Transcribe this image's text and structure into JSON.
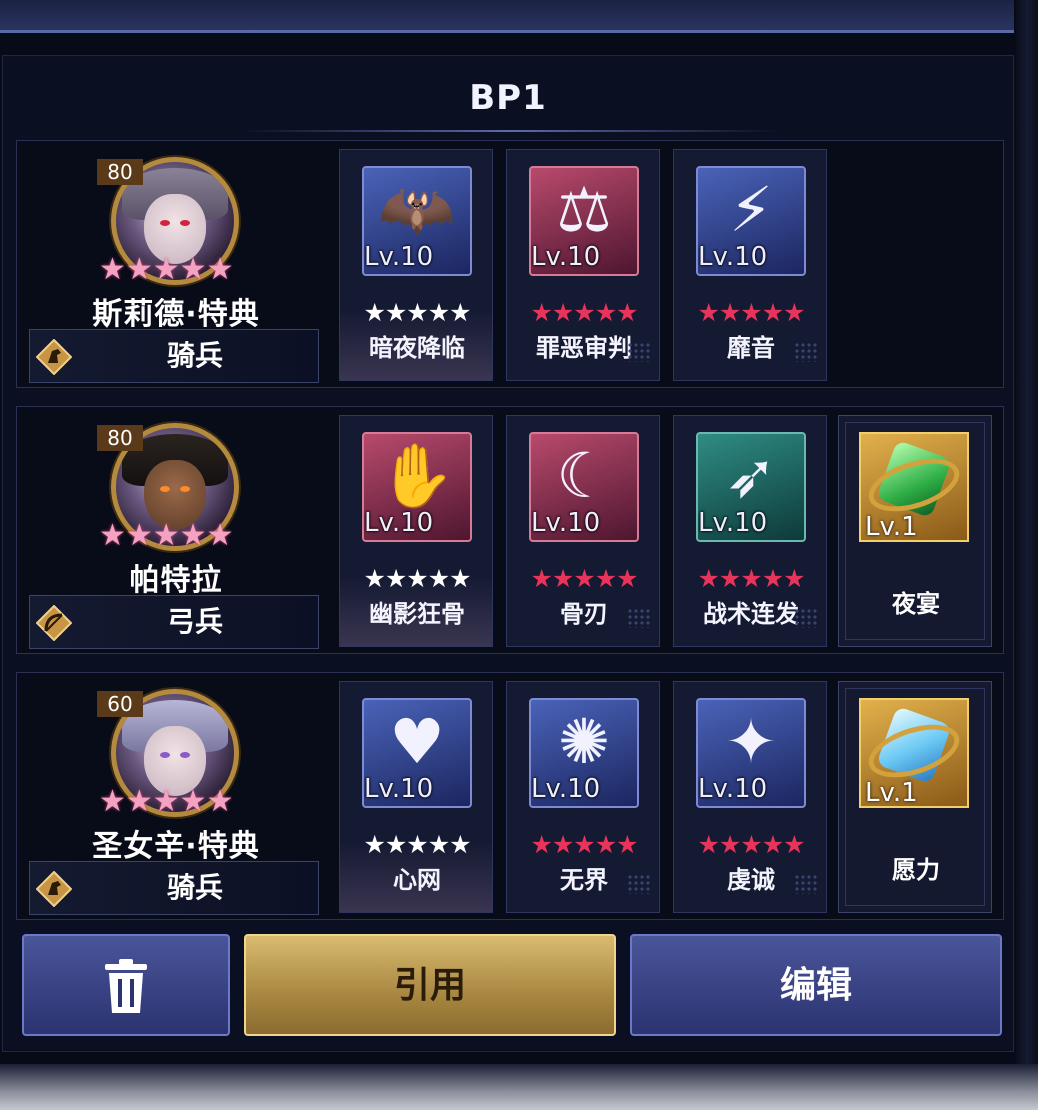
{
  "title": "BP1",
  "heroes": [
    {
      "level": "80",
      "name": "斯莉德·特典",
      "class": "骑兵",
      "class_icon": "horse-icon",
      "stars": "★★★★★",
      "skills": [
        {
          "icon": "bat-icon",
          "level": "Lv.10",
          "stars": "★★★★★",
          "star_color": "white",
          "name": "暗夜降临",
          "color": "blue"
        },
        {
          "icon": "scales-icon",
          "level": "Lv.10",
          "stars": "★★★★★",
          "star_color": "red",
          "name": "罪恶审判",
          "color": "red"
        },
        {
          "icon": "lightning-icon",
          "level": "Lv.10",
          "stars": "★★★★★",
          "star_color": "red",
          "name": "靡音",
          "color": "blue"
        }
      ]
    },
    {
      "level": "80",
      "name": "帕特拉",
      "class": "弓兵",
      "class_icon": "bow-icon",
      "stars": "★★★★★",
      "skills": [
        {
          "icon": "claw-icon",
          "level": "Lv.10",
          "stars": "★★★★★",
          "star_color": "white",
          "name": "幽影狂骨",
          "color": "red"
        },
        {
          "icon": "scythe-icon",
          "level": "Lv.10",
          "stars": "★★★★★",
          "star_color": "red",
          "name": "骨刃",
          "color": "red"
        },
        {
          "icon": "arrows-icon",
          "level": "Lv.10",
          "stars": "★★★★★",
          "star_color": "red",
          "name": "战术连发",
          "color": "teal"
        }
      ],
      "relic": {
        "icon": "green-gem-icon",
        "level": "Lv.1",
        "name": "夜宴",
        "color": "#3fc85a"
      }
    },
    {
      "level": "60",
      "name": "圣女辛·特典",
      "class": "骑兵",
      "class_icon": "horse-icon",
      "stars": "★★★★★",
      "skills": [
        {
          "icon": "heart-icon",
          "level": "Lv.10",
          "stars": "★★★★★",
          "star_color": "white",
          "name": "心网",
          "color": "blue"
        },
        {
          "icon": "vortex-icon",
          "level": "Lv.10",
          "stars": "★★★★★",
          "star_color": "red",
          "name": "无界",
          "color": "blue"
        },
        {
          "icon": "wings-icon",
          "level": "Lv.10",
          "stars": "★★★★★",
          "star_color": "red",
          "name": "虔诚",
          "color": "blue"
        }
      ],
      "relic": {
        "icon": "blue-gem-icon",
        "level": "Lv.1",
        "name": "愿力",
        "color": "#6ac8f4"
      }
    }
  ],
  "buttons": {
    "delete_icon": "trash-icon",
    "use_label": "引用",
    "edit_label": "编辑"
  }
}
